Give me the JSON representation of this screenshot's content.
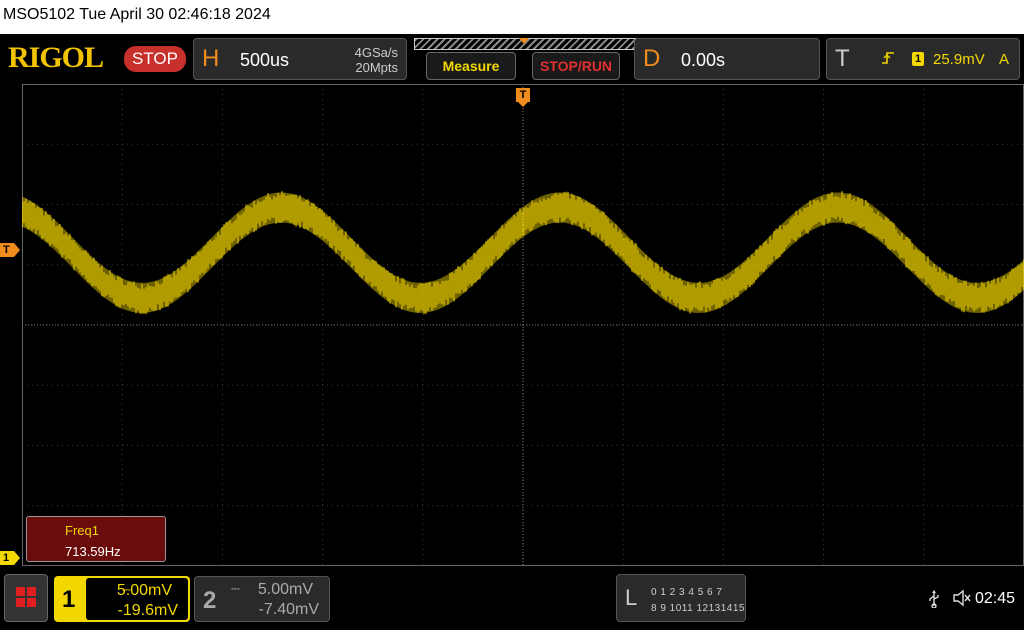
{
  "header": {
    "title": "MSO5102  Tue April 30 02:46:18 2024"
  },
  "topbar": {
    "logo": "RIGOL",
    "run_state": "STOP",
    "horizontal": {
      "letter": "H",
      "timebase": "500us",
      "sample_rate": "4GSa/s",
      "memory_depth": "20Mpts"
    },
    "measure_label": "Measure",
    "stop_run_label": "STOP/RUN",
    "delay": {
      "letter": "D",
      "value": "0.00s"
    },
    "trigger": {
      "letter": "T",
      "edge_glyph": "⌄",
      "source": "1",
      "level": "25.9mV",
      "mode": "A"
    }
  },
  "screen": {
    "trigger_marker": "T",
    "trigger_level_marker": "T",
    "ch1_marker": "1",
    "waveform": {
      "color": "#f2d800",
      "frequency_hz": 713.59,
      "cycles_visible": 3.6,
      "center_div": 2.8,
      "amplitude_div": 0.75,
      "noise_div": 0.25
    }
  },
  "measurement": {
    "name": "Freq1",
    "value": "713.59Hz"
  },
  "bottombar": {
    "ch1": {
      "number": "1",
      "coupling": "⎓",
      "scale": "5.00mV",
      "offset": "-19.6mV"
    },
    "ch2": {
      "number": "2",
      "coupling": "⎓",
      "scale": "5.00mV",
      "offset": "-7.40mV"
    },
    "logic": {
      "letter": "L",
      "row1": "0 1 2 3  4 5 6 7",
      "row2": "8 9 1011 12131415"
    },
    "usb_icon": "usb-icon",
    "speaker_icon": "speaker-muted-icon",
    "clock": "02:45"
  },
  "colors": {
    "accent_orange": "#f08c1e",
    "channel1": "#f2d800",
    "stop_red": "#c8302c"
  }
}
